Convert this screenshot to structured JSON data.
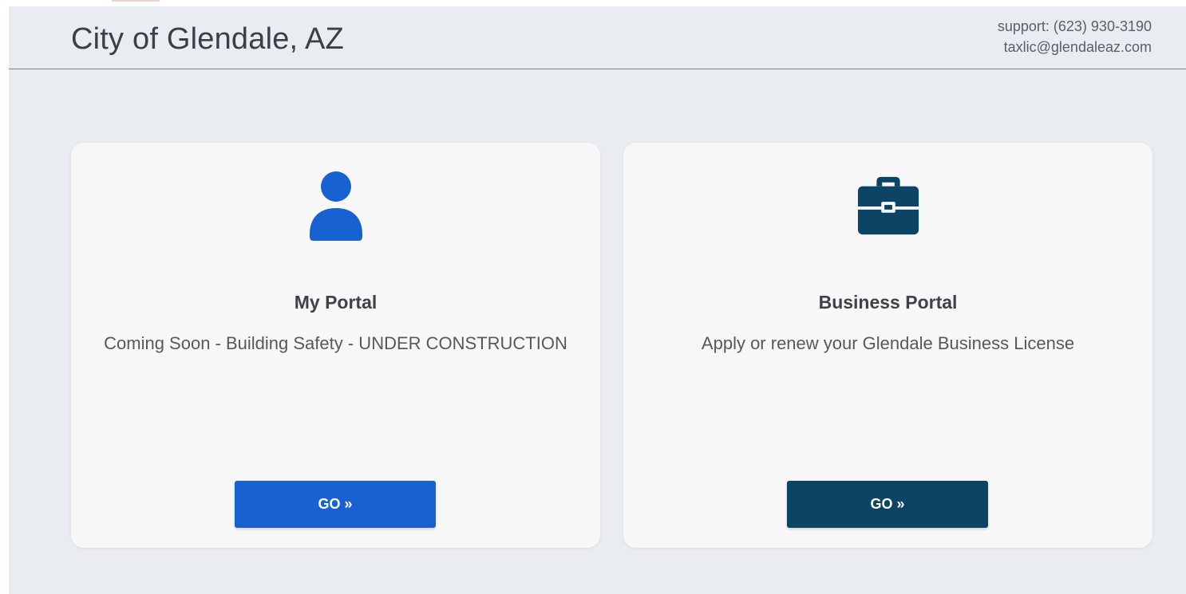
{
  "header": {
    "title": "City of Glendale, AZ",
    "support_phone": "support: (623) 930-3190",
    "support_email": "taxlic@glendaleaz.com"
  },
  "cards": [
    {
      "icon": "user-icon",
      "icon_color": "#1761d1",
      "title": "My Portal",
      "description": "Coming Soon - Building Safety - UNDER CONSTRUCTION",
      "button_label": "GO »",
      "button_color": "#1761d1"
    },
    {
      "icon": "briefcase-icon",
      "icon_color": "#0c4466",
      "title": "Business Portal",
      "description": "Apply or renew your Glendale Business License",
      "button_label": "GO »",
      "button_color": "#0c4466"
    }
  ]
}
